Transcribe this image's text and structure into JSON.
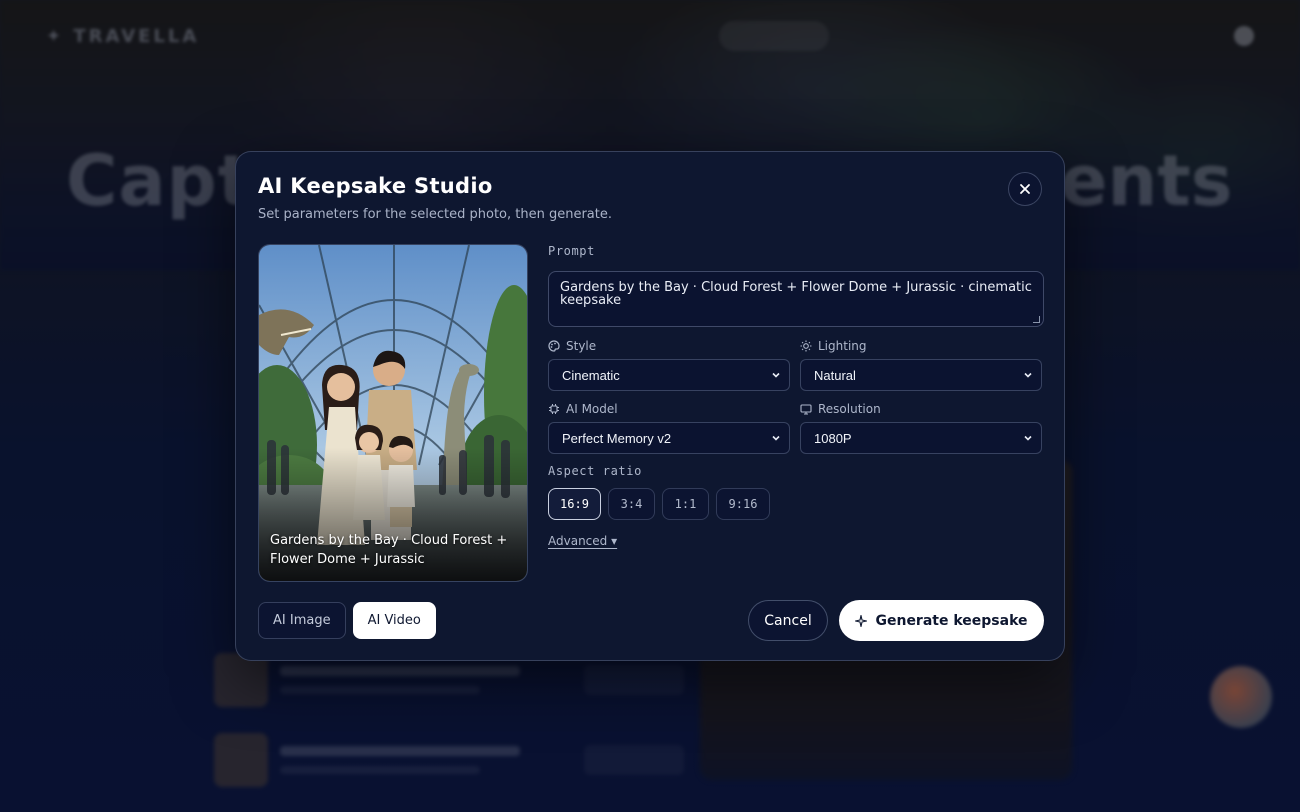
{
  "background": {
    "logo": "✦ TRAVELLA",
    "hero_title_left": "Capt",
    "hero_title_right": "ents"
  },
  "modal": {
    "title": "AI Keepsake Studio",
    "subtitle": "Set parameters for the selected photo, then generate.",
    "close_icon": "close-icon"
  },
  "photo": {
    "caption": "Gardens by the Bay · Cloud Forest + Flower Dome + Jurassic"
  },
  "form": {
    "prompt_label": "Prompt",
    "prompt_value": "Gardens by the Bay · Cloud Forest + Flower Dome + Jurassic · cinematic keepsake",
    "style": {
      "label": "Style",
      "icon": "palette-icon",
      "value": "Cinematic"
    },
    "lighting": {
      "label": "Lighting",
      "icon": "sun-icon",
      "value": "Natural"
    },
    "model": {
      "label": "AI Model",
      "icon": "chip-icon",
      "value": "Perfect Memory v2"
    },
    "resolution": {
      "label": "Resolution",
      "icon": "monitor-icon",
      "value": "1080P"
    },
    "aspect_label": "Aspect ratio",
    "aspect_options": [
      "16:9",
      "3:4",
      "1:1",
      "9:16"
    ],
    "aspect_selected": "16:9",
    "advanced": "Advanced ▾"
  },
  "footer": {
    "mode_tabs": [
      "AI Image",
      "AI Video"
    ],
    "mode_selected": "AI Video",
    "cancel": "Cancel",
    "generate": "Generate keepsake"
  },
  "colors": {
    "modal_bg": "#0e1730",
    "page_bg": "#0a1230",
    "accent": "#ffffff"
  }
}
